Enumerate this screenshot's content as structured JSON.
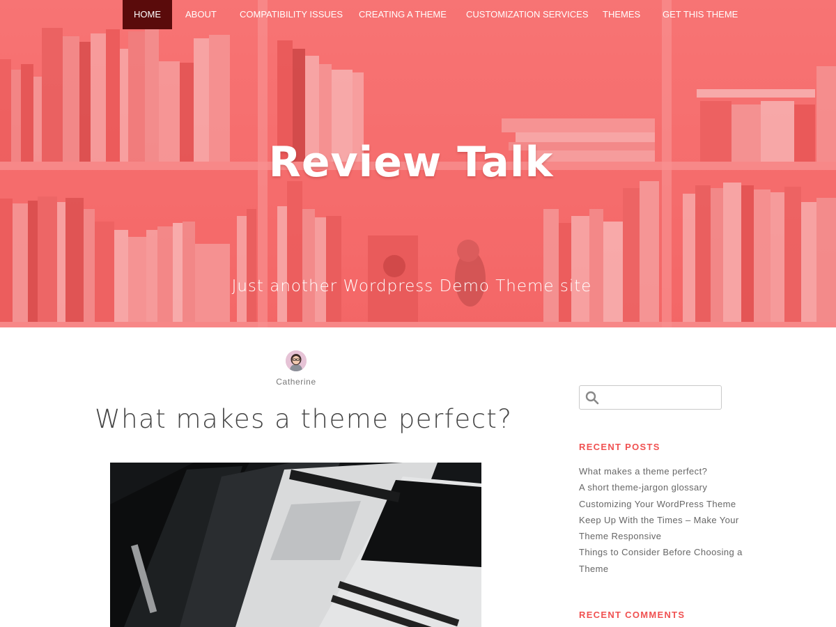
{
  "nav": {
    "items": [
      {
        "label": "HOME",
        "active": true
      },
      {
        "label": "ABOUT"
      },
      {
        "label": "COMPATIBILITY ISSUES"
      },
      {
        "label": "CREATING A THEME"
      },
      {
        "label": "CUSTOMIZATION SERVICES"
      },
      {
        "label": "THEMES"
      },
      {
        "label": "GET THIS THEME"
      }
    ]
  },
  "header": {
    "title": "Review Talk",
    "tagline": "Just another Wordpress Demo Theme site"
  },
  "post": {
    "author": "Catherine",
    "title": "What makes a theme perfect?"
  },
  "sidebar": {
    "search": {
      "value": "",
      "icon": "search-icon"
    },
    "recent_posts": {
      "title": "RECENT POSTS",
      "items": [
        "What makes a theme perfect?",
        "A short theme-jargon glossary",
        "Customizing Your WordPress Theme",
        "Keep Up With the Times – Make Your Theme Responsive",
        "Things to Consider Before Choosing a Theme"
      ]
    },
    "recent_comments": {
      "title": "RECENT COMMENTS"
    }
  },
  "colors": {
    "hero_overlay": "#f56e6e",
    "nav_active": "#5a0b0b",
    "widget_title": "#f05151",
    "link_text": "#666666"
  }
}
